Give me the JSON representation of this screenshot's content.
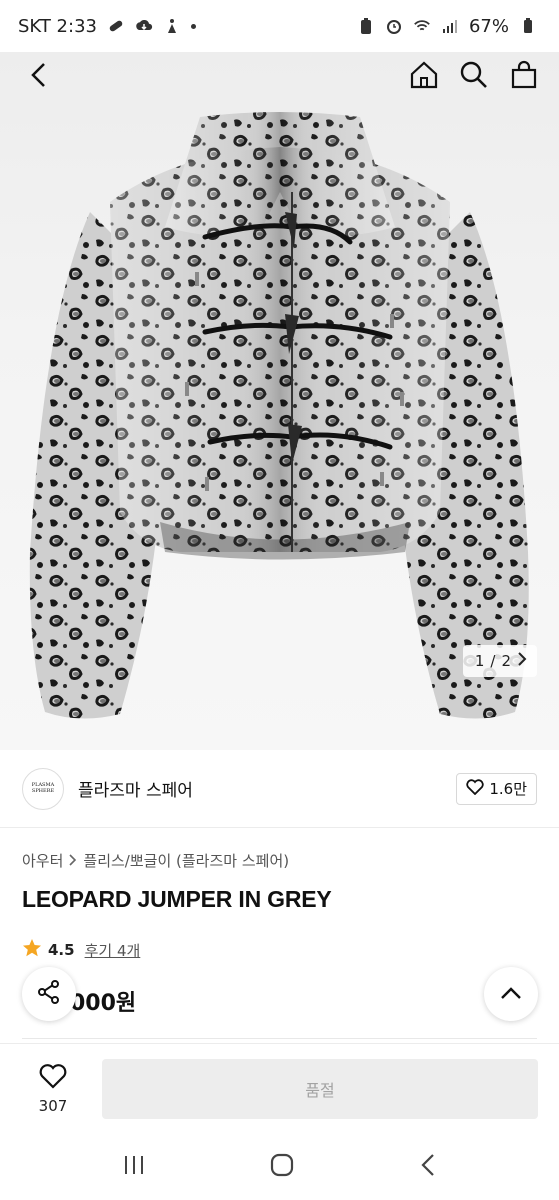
{
  "status_bar": {
    "carrier_time": "SKT 2:33",
    "battery": "67%"
  },
  "nav": {
    "back_icon": "chevron-left-icon",
    "home_icon": "home-icon",
    "search_icon": "search-icon",
    "bag_icon": "shopping-bag-icon"
  },
  "gallery": {
    "current": "1",
    "separator": "/",
    "total": "2"
  },
  "seller": {
    "logo_text": "PLASMA SPHERE",
    "name": "플라즈마 스페어",
    "likes": "1.6만"
  },
  "product": {
    "breadcrumb_1": "아우터",
    "breadcrumb_2": "플리스/뽀글이 (플라즈마 스페어)",
    "title": "LEOPARD JUMPER IN GREY",
    "rating": "4.5",
    "reviews": "후기 4개",
    "price": "000원"
  },
  "action_bar": {
    "wish_count": "307",
    "soldout_label": "품절"
  },
  "colors": {
    "star": "#f5a623",
    "button_bg": "#ededed",
    "button_text": "#a3a3a3"
  }
}
